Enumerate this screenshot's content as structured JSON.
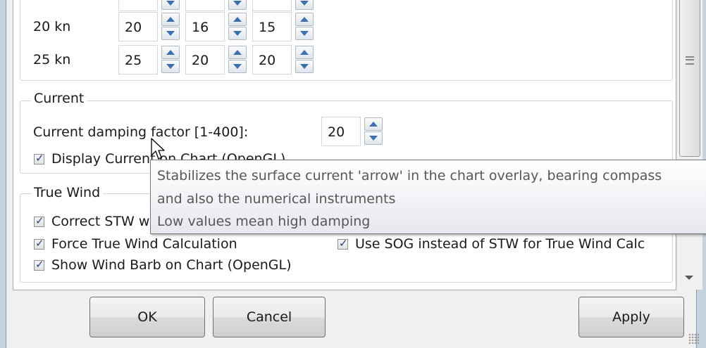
{
  "speed_table": {
    "rows": [
      {
        "label": "",
        "values": [
          "",
          "",
          ""
        ]
      },
      {
        "label": "20 kn",
        "values": [
          "20",
          "16",
          "15"
        ]
      },
      {
        "label": "25 kn",
        "values": [
          "25",
          "20",
          "20"
        ]
      }
    ]
  },
  "current": {
    "legend": "Current",
    "damping_label": "Current damping factor [1-400]:",
    "damping_value": "20",
    "display_on_chart_label": "Display Current on Chart (OpenGL)",
    "display_on_chart_checked": true
  },
  "true_wind": {
    "legend": "True Wind",
    "correct_stw_label": "Correct STW w",
    "correct_stw_checked": true,
    "force_calc_label": "Force True Wind Calculation",
    "force_calc_checked": true,
    "use_sog_label": "Use SOG instead of STW for True Wind Calc",
    "use_sog_checked": true,
    "wind_barb_label": "Show Wind Barb on Chart (OpenGL)",
    "wind_barb_checked": true
  },
  "tooltip": {
    "line1": "Stabilizes the surface current 'arrow' in the chart overlay, bearing compass",
    "line2": "and also the numerical instruments",
    "line3": "Low values mean high damping"
  },
  "buttons": {
    "ok": "OK",
    "cancel": "Cancel",
    "apply": "Apply"
  },
  "colors": {
    "accent": "#3a6fb0",
    "check": "#21448a",
    "tooltip_text": "#575757"
  },
  "icons": {
    "spin_up": "triangle-up",
    "spin_down": "triangle-down",
    "check": "checkmark",
    "scroll_grip": "three-lines",
    "cursor": "arrow-pointer"
  }
}
